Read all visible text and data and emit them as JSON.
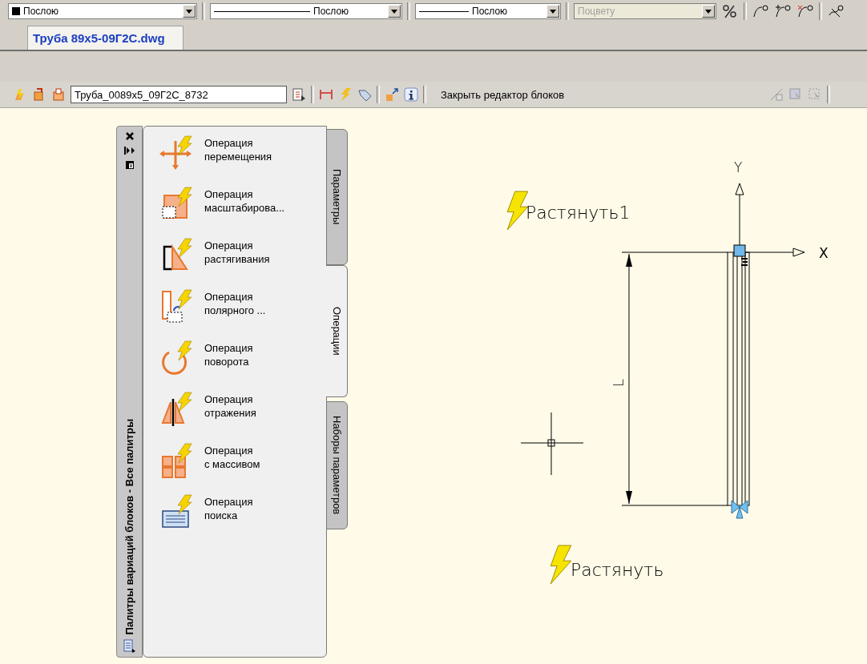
{
  "properties_toolbar": {
    "combos": [
      {
        "kind": "layer",
        "value": "Послою",
        "disabled": false
      },
      {
        "kind": "linetype",
        "value": "Послою",
        "disabled": false
      },
      {
        "kind": "lineweight",
        "value": "Послою",
        "disabled": false
      },
      {
        "kind": "plotstyle",
        "value": "Поцвету",
        "disabled": true
      }
    ]
  },
  "document_tabs": [
    {
      "label": "Труба 89x5-09Г2С.dwg",
      "selected": true
    }
  ],
  "block_editor_toolbar": {
    "block_name": "Труба_0089x5_09Г2С_8732",
    "close_button": "Закрыть редактор блоков"
  },
  "palette": {
    "title": "Палитры вариаций блоков - Все палитры",
    "items": [
      {
        "kind": "move",
        "label": "Операция\nперемещения"
      },
      {
        "kind": "scale",
        "label": "Операция\nмасштабирова..."
      },
      {
        "kind": "stretch",
        "label": "Операция\nрастягивания"
      },
      {
        "kind": "polar",
        "label": "Операция\nполярного ..."
      },
      {
        "kind": "rotate",
        "label": "Операция\nповорота"
      },
      {
        "kind": "flip",
        "label": "Операция\nотражения"
      },
      {
        "kind": "array",
        "label": "Операция\nс массивом"
      },
      {
        "kind": "lookup",
        "label": "Операция\nпоиска"
      }
    ],
    "tabs": [
      {
        "label": "Параметры",
        "selected": false
      },
      {
        "label": "Операции",
        "selected": true
      },
      {
        "label": "Наборы параметров",
        "selected": false
      }
    ]
  },
  "drawing": {
    "parameters": [
      {
        "label": "Растянуть1"
      },
      {
        "label": "Растянуть"
      }
    ],
    "dimension_label": "L",
    "axes": {
      "x": "X",
      "y": "Y"
    }
  }
}
